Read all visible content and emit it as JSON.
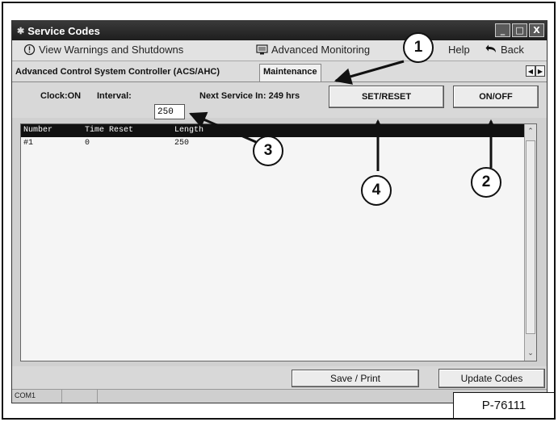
{
  "window": {
    "title": "Service Codes",
    "controls": {
      "minimize": "_",
      "maximize": "□",
      "close": "X"
    }
  },
  "toolbar": {
    "warnings_label": "View Warnings and Shutdowns",
    "monitoring_label": "Advanced Monitoring",
    "help_label": "Help",
    "back_label": "Back"
  },
  "tabs": {
    "controller": "Advanced Control System Controller (ACS/AHC)",
    "maintenance": "Maintenance"
  },
  "controls": {
    "clock": "Clock:ON",
    "interval_label": "Interval:",
    "interval_value": "250",
    "next_service": "Next Service In: 249 hrs",
    "set_reset": "SET/RESET",
    "on_off": "ON/OFF"
  },
  "table": {
    "headers": [
      "Number",
      "Time Reset",
      "Length"
    ],
    "rows": [
      [
        "#1",
        "0",
        "250"
      ]
    ]
  },
  "bottom": {
    "save_print": "Save / Print",
    "update_codes": "Update Codes"
  },
  "statusbar": {
    "port": "COM1"
  },
  "figure": {
    "part_number": "P-76111",
    "callouts": [
      "1",
      "2",
      "3",
      "4"
    ]
  },
  "icons": {
    "warning": "warning-circle-icon",
    "monitoring": "monitor-icon",
    "back": "back-arrow-icon",
    "app": "app-icon"
  }
}
